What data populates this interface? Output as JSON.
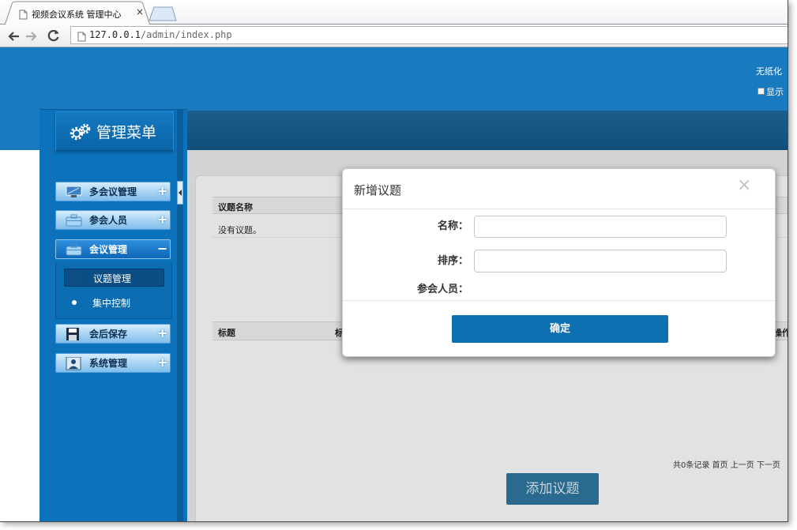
{
  "browser": {
    "tab_title": "视频会议系统 管理中心",
    "tab_close": "×",
    "url_host": "127.0.0.1",
    "url_path": "/admin/index.php",
    "icons": [
      "page-icon",
      "back-arrow-icon",
      "forward-arrow-icon",
      "reload-icon",
      "new-tab-button"
    ]
  },
  "header": {
    "system_name": "无纸化",
    "show_label": "显示",
    "show_checked": false
  },
  "sidebar": {
    "title": "管理菜单",
    "title_icon": "gear-icon",
    "items": [
      {
        "label": "多会议管理",
        "toggle": "+",
        "icon": "monitor-icon"
      },
      {
        "label": "参会人员",
        "toggle": "+",
        "icon": "briefcase-icon"
      },
      {
        "label": "会议管理",
        "toggle": "−",
        "icon": "briefcase-icon",
        "expanded": true,
        "children": [
          {
            "label": "议题管理",
            "selected": true
          },
          {
            "label": "集中控制",
            "selected": false
          }
        ]
      },
      {
        "label": "会后保存",
        "toggle": "+",
        "icon": "save-icon"
      },
      {
        "label": "系统管理",
        "toggle": "+",
        "icon": "user-icon"
      }
    ]
  },
  "main": {
    "topic_table": {
      "headers": [
        "议题名称"
      ],
      "empty_text": "没有议题。"
    },
    "detail_table": {
      "headers": [
        "标题",
        "标",
        "操作"
      ]
    },
    "pagination": "共0条记录 首页 上一页 下一页",
    "add_button": "添加议题"
  },
  "modal": {
    "title": "新增议题",
    "close": "×",
    "fields": [
      {
        "label": "名称：",
        "value": ""
      },
      {
        "label": "排序：",
        "value": ""
      },
      {
        "label": "参会人员："
      }
    ],
    "submit": "确定"
  },
  "colors": {
    "header_blue": "#1a7abf",
    "sidebar_blue": "#0b72bb",
    "active_menu": "#0f67b7",
    "primary_button": "#0e70b1",
    "dimmed_button": "#2a6a8f"
  }
}
